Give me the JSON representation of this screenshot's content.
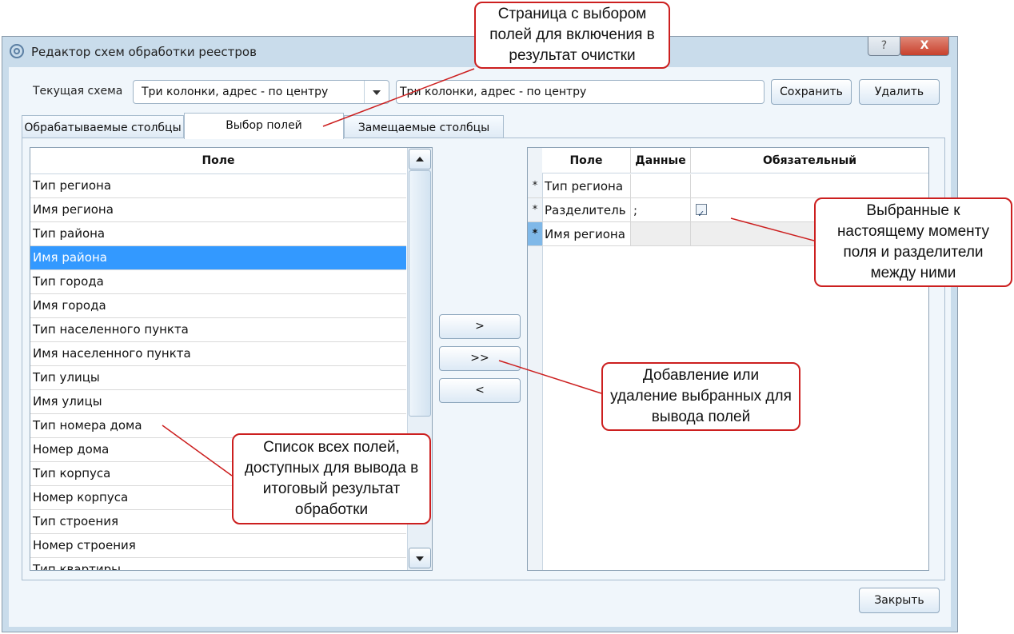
{
  "window": {
    "title": "Редактор схем обработки реестров",
    "help_label": "?",
    "close_label": "X"
  },
  "scheme": {
    "label": "Текущая схема",
    "selected": "Три колонки, адрес - по центру",
    "name_value": "Три колонки, адрес - по центру",
    "save_label": "Сохранить",
    "delete_label": "Удалить"
  },
  "tabs": [
    {
      "label": "Обрабатываемые столбцы"
    },
    {
      "label": "Выбор полей"
    },
    {
      "label": "Замещаемые столбцы"
    }
  ],
  "fields_list": {
    "header": "Поле",
    "items": [
      "Тип региона",
      "Имя региона",
      "Тип района",
      "Имя района",
      "Тип города",
      "Имя города",
      "Тип населенного пункта",
      "Имя населенного пункта",
      "Тип улицы",
      "Имя улицы",
      "Тип номера дома",
      "Номер дома",
      "Тип корпуса",
      "Номер корпуса",
      "Тип строения",
      "Номер строения",
      "Тип квартиры"
    ],
    "selected_index": 3
  },
  "move_buttons": {
    "add": ">",
    "add_all": ">>",
    "remove": "<"
  },
  "selected_grid": {
    "headers": [
      "Поле",
      "Данные",
      "Обязательный"
    ],
    "rows": [
      {
        "marker": "*",
        "field": "Тип региона",
        "data": "",
        "required": false
      },
      {
        "marker": "*",
        "field": "Разделитель",
        "data": ";",
        "required": true
      },
      {
        "marker": "*",
        "field": "Имя региона",
        "data": "",
        "required": false
      }
    ]
  },
  "footer": {
    "close_label": "Закрыть"
  },
  "callouts": {
    "tab_page": "Страница с выбором полей для включения в результат очистки",
    "selected_fields": "Выбранные к настоящему моменту поля и разделители между ними",
    "buttons": "Добавление или удаление выбранных для вывода полей",
    "all_fields": "Список всех полей, доступных для вывода в итоговый результат обработки"
  },
  "colors": {
    "selection": "#3399ff",
    "callout_border": "#cc1f1f",
    "window_frame": "#c9dceb"
  }
}
